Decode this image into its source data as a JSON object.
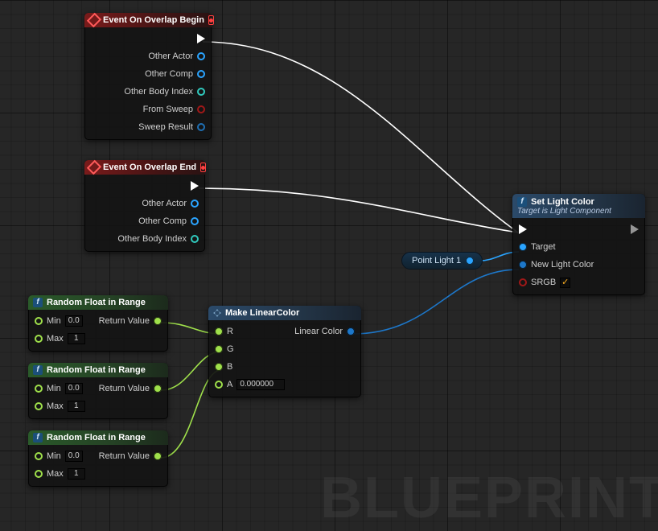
{
  "watermark": "BLUEPRINT",
  "nodes": {
    "overlap_begin": {
      "title": "Event On Overlap Begin",
      "pins": {
        "other_actor": "Other Actor",
        "other_comp": "Other Comp",
        "other_body_index": "Other Body Index",
        "from_sweep": "From Sweep",
        "sweep_result": "Sweep Result"
      }
    },
    "overlap_end": {
      "title": "Event On Overlap End",
      "pins": {
        "other_actor": "Other Actor",
        "other_comp": "Other Comp",
        "other_body_index": "Other Body Index"
      }
    },
    "rand_float": {
      "title": "Random Float in Range",
      "min_label": "Min",
      "max_label": "Max",
      "min_value": "0.0",
      "max_value": "1",
      "return_label": "Return Value"
    },
    "make_color": {
      "title": "Make LinearColor",
      "r": "R",
      "g": "G",
      "b": "B",
      "a": "A",
      "a_value": "0.000000",
      "out": "Linear Color"
    },
    "set_light": {
      "title": "Set Light Color",
      "subtitle": "Target is Light Component",
      "target": "Target",
      "new_color": "New Light Color",
      "srgb": "SRGB",
      "srgb_checked": true
    },
    "point_light": {
      "label": "Point Light 1"
    }
  },
  "colors": {
    "exec": "#ffffff",
    "object": "#2aa4ff",
    "float": "#9fe04b",
    "linearcolor": "#1d77c9",
    "bool": "#a01818",
    "struct": "#1f6fb3",
    "wildint": "#30c9bd"
  }
}
